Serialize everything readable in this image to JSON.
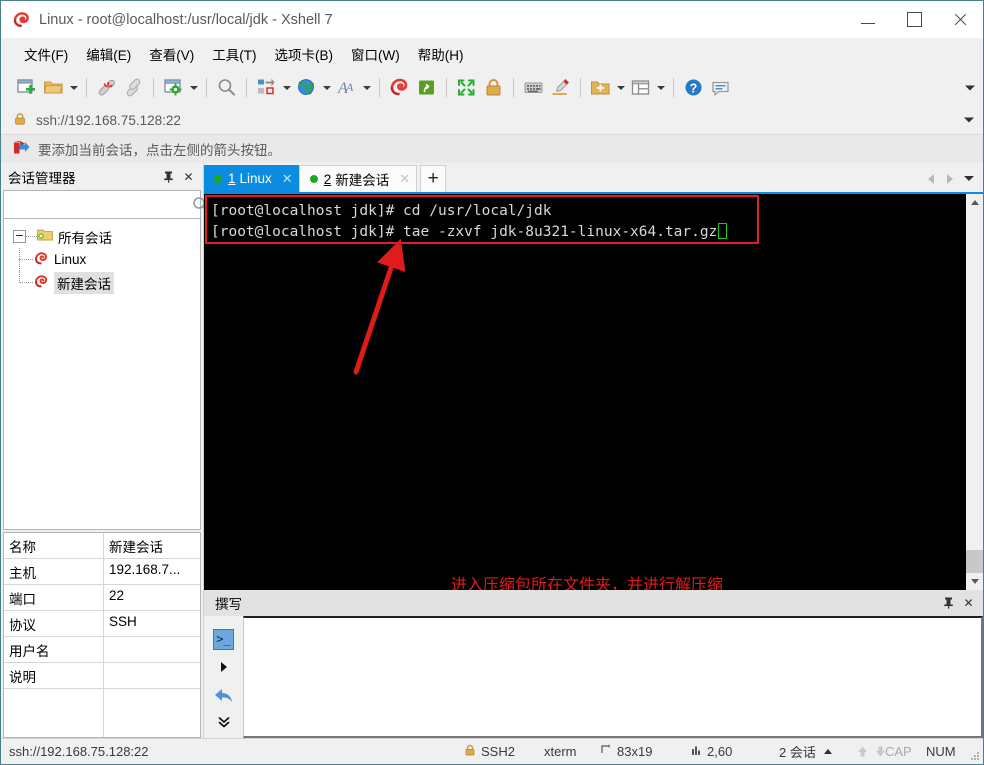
{
  "window": {
    "title": "Linux - root@localhost:/usr/local/jdk - Xshell 7",
    "logo_icon": "xshell-logo-icon",
    "minimize_label": "—",
    "maximize_label": "□",
    "close_label": "✕"
  },
  "menubar": {
    "items": [
      {
        "label": "文件(F)",
        "name": "menu-file"
      },
      {
        "label": "编辑(E)",
        "name": "menu-edit"
      },
      {
        "label": "查看(V)",
        "name": "menu-view"
      },
      {
        "label": "工具(T)",
        "name": "menu-tools"
      },
      {
        "label": "选项卡(B)",
        "name": "menu-tabs"
      },
      {
        "label": "窗口(W)",
        "name": "menu-window"
      },
      {
        "label": "帮助(H)",
        "name": "menu-help"
      }
    ]
  },
  "toolbar": {
    "overflow_label": "▼",
    "buttons": [
      {
        "icon": "new-session-icon",
        "has_caret": false
      },
      {
        "icon": "open-folder-icon",
        "has_caret": true
      },
      {
        "sep": true
      },
      {
        "icon": "disconnect-icon",
        "has_caret": false
      },
      {
        "icon": "reconnect-icon",
        "has_caret": false
      },
      {
        "sep": true
      },
      {
        "icon": "session-properties-icon",
        "has_caret": true
      },
      {
        "sep": true
      },
      {
        "icon": "find-icon",
        "has_caret": false
      },
      {
        "sep": true
      },
      {
        "icon": "layout-arrange-icon",
        "has_caret": true
      },
      {
        "icon": "globe-icon",
        "has_caret": true
      },
      {
        "icon": "font-icon",
        "has_caret": true
      },
      {
        "sep": true
      },
      {
        "icon": "xshell-icon",
        "has_caret": false
      },
      {
        "icon": "xftp-icon",
        "has_caret": false
      },
      {
        "sep": true
      },
      {
        "icon": "fullscreen-icon",
        "has_caret": false
      },
      {
        "icon": "lock-icon",
        "has_caret": false
      },
      {
        "sep": true
      },
      {
        "icon": "keyboard-icon",
        "has_caret": false
      },
      {
        "icon": "highlight-pen-icon",
        "has_caret": false
      },
      {
        "sep": true
      },
      {
        "icon": "add-folder-icon",
        "has_caret": true
      },
      {
        "icon": "split-layout-icon",
        "has_caret": true
      },
      {
        "sep": true
      },
      {
        "icon": "help-icon",
        "has_caret": false
      },
      {
        "icon": "chat-icon",
        "has_caret": false
      }
    ]
  },
  "addressbar": {
    "lock_icon": "lock-icon",
    "url": "ssh://192.168.75.128:22",
    "dropdown_label": "▼"
  },
  "infobar": {
    "icon": "red-arrow-icon",
    "text": "要添加当前会话，点击左侧的箭头按钮。"
  },
  "sidebar": {
    "title": "会话管理器",
    "pin_label": "⚐",
    "close_label": "✕",
    "search": {
      "value": "",
      "placeholder": "",
      "icon": "search-icon"
    },
    "tree": {
      "root": {
        "label": "所有会话",
        "icon": "folder-sessions-icon"
      },
      "children": [
        {
          "label": "Linux",
          "icon": "session-icon",
          "selected": false
        },
        {
          "label": "新建会话",
          "icon": "session-icon",
          "selected": true
        }
      ]
    },
    "properties": [
      {
        "key": "名称",
        "value": "新建会话"
      },
      {
        "key": "主机",
        "value": "192.168.7..."
      },
      {
        "key": "端口",
        "value": "22"
      },
      {
        "key": "协议",
        "value": "SSH"
      },
      {
        "key": "用户名",
        "value": ""
      },
      {
        "key": "说明",
        "value": ""
      }
    ]
  },
  "tabs": {
    "items": [
      {
        "number": "1",
        "label": "Linux",
        "active": true,
        "close_label": "✕",
        "dot_color": "#1ea81e"
      },
      {
        "number": "2",
        "label": "新建会话",
        "active": false,
        "close_label": "✕",
        "dot_color": "#1ea81e"
      }
    ],
    "add_label": "+",
    "nav_prev": "◀",
    "nav_next": "▶",
    "nav_menu": "▼"
  },
  "terminal": {
    "lines": [
      "[root@localhost jdk]# cd /usr/local/jdk",
      "[root@localhost jdk]# tae -zxvf jdk-8u321-linux-x64.tar.gz"
    ],
    "background": "#000000",
    "foreground": "#d8d8d8",
    "cursor_color": "#22c522",
    "annotation": {
      "text": "进入压缩包所在文件夹，并进行解压缩",
      "color": "#e01b1b",
      "arrow": "red-arrow-annotation",
      "highlight_color": "#e02020"
    },
    "scrollbar": {
      "up": "▲",
      "down": "▼"
    }
  },
  "compose": {
    "title": "撰写",
    "pin_label": "⚐",
    "close_label": "✕",
    "input_value": "",
    "input_placeholder": "",
    "tools": [
      {
        "icon": "command-prompt-icon",
        "name": "compose-prompt-button"
      },
      {
        "icon": "send-arrow-icon",
        "name": "compose-send-button"
      },
      {
        "icon": "undo-arrow-icon",
        "name": "compose-undo-button"
      }
    ],
    "expand_icon": "double-chevron-down-icon"
  },
  "statusbar": {
    "url": "ssh://192.168.75.128:22",
    "security": "SSH2",
    "terminal_type": "xterm",
    "size": "83x19",
    "cursor_pos": "2,60",
    "sessions": "2 会话",
    "sessions_caret": "▲",
    "cap": "CAP",
    "num": "NUM",
    "size_icon": "resize-icon",
    "cursor_icon": "cursor-icon",
    "lock_icon": "lock-icon"
  }
}
